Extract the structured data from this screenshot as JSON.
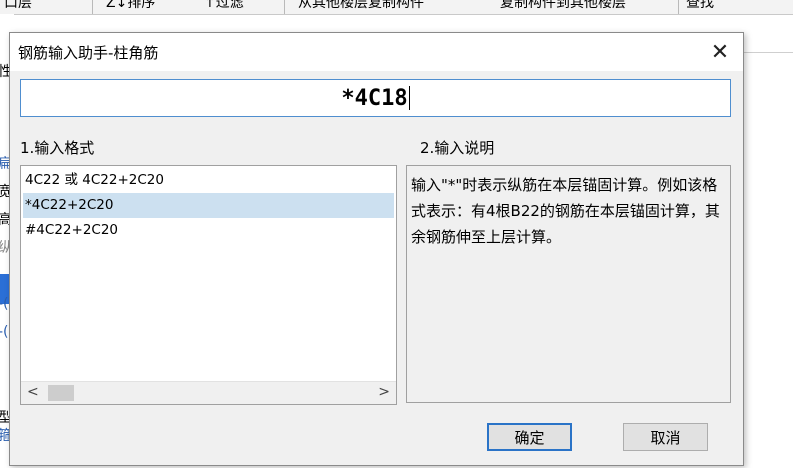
{
  "background_app": {
    "toolbar_fragments": [
      "口层",
      "Z↓排序",
      "↑过滤",
      "从其他楼层复制构件",
      "复制构件到其他楼层",
      "查找"
    ],
    "left_fragments": [
      "性",
      "扁",
      "宽",
      "高",
      "纵",
      "-(",
      "-(",
      "型",
      "箍"
    ]
  },
  "dialog": {
    "title": "钢筋输入助手-柱角筋",
    "close_glyph": "✕",
    "input_value": "*4C18",
    "format_label": "1.输入格式",
    "desc_label": "2.输入说明",
    "formats": [
      {
        "text": "4C22 或 4C22+2C20",
        "selected": false
      },
      {
        "text": "*4C22+2C20",
        "selected": true
      },
      {
        "text": "#4C22+2C20",
        "selected": false
      }
    ],
    "description": "输入\"*\"时表示纵筋在本层锚固计算。例如该格式表示：有4根B22的钢筋在本层锚固计算，其余钢筋伸至上层计算。",
    "ok_label": "确定",
    "cancel_label": "取消",
    "accent_color": "#2a73c7"
  }
}
